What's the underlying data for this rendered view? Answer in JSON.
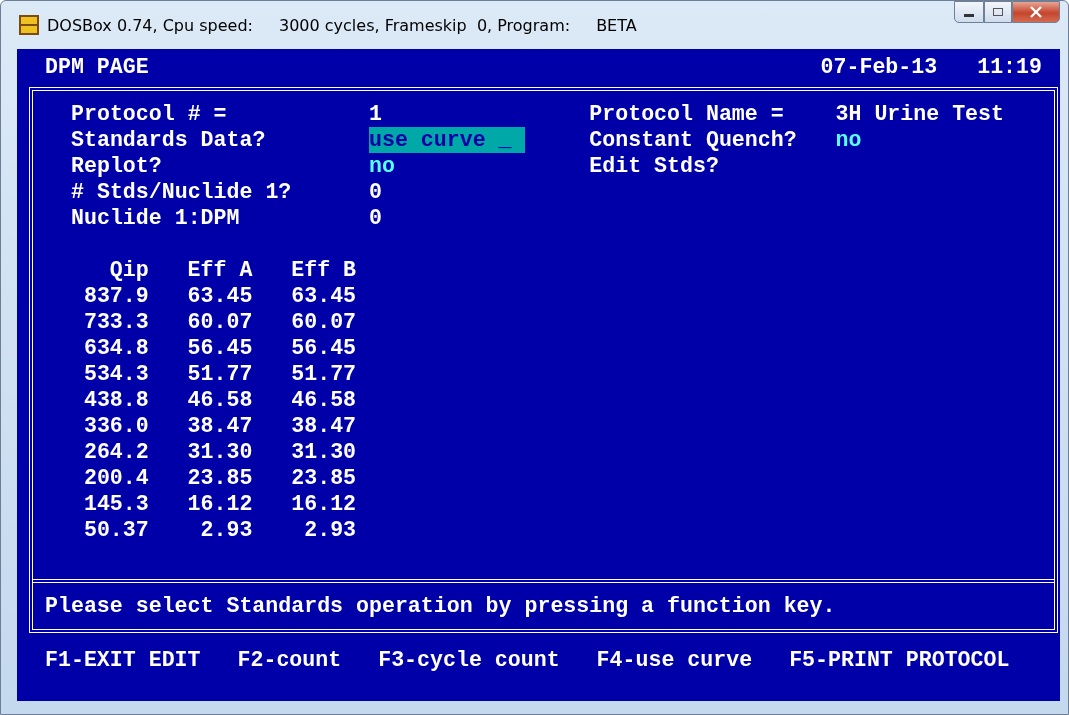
{
  "window": {
    "title_parts": [
      "DOSBox 0.74, Cpu speed:",
      "3000 cycles, Frameskip  0, Program:",
      "BETA"
    ]
  },
  "header": {
    "page": "DPM PAGE",
    "date": "07-Feb-13",
    "time": "11:19"
  },
  "left_fields": [
    {
      "label": "Protocol # =",
      "value": "1",
      "kind": "plain"
    },
    {
      "label": "Standards Data?",
      "value": "use curve _",
      "kind": "input"
    },
    {
      "label": "Replot?",
      "value": "no",
      "kind": "option"
    },
    {
      "label": "# Stds/Nuclide 1?",
      "value": "0",
      "kind": "plain"
    },
    {
      "label": "Nuclide 1:DPM",
      "value": "0",
      "kind": "plain"
    }
  ],
  "right_fields": [
    {
      "label": "Protocol Name =",
      "value": "3H Urine Test",
      "kind": "plain"
    },
    {
      "label": "Constant Quench?",
      "value": "no",
      "kind": "option"
    },
    {
      "label": "Edit Stds?",
      "kind": "none"
    }
  ],
  "table": {
    "columns": [
      "Qip",
      "Eff A",
      "Eff B"
    ],
    "rows": [
      [
        "837.9",
        "63.45",
        "63.45"
      ],
      [
        "733.3",
        "60.07",
        "60.07"
      ],
      [
        "634.8",
        "56.45",
        "56.45"
      ],
      [
        "534.3",
        "51.77",
        "51.77"
      ],
      [
        "438.8",
        "46.58",
        "46.58"
      ],
      [
        "336.0",
        "38.47",
        "38.47"
      ],
      [
        "264.2",
        "31.30",
        "31.30"
      ],
      [
        "200.4",
        "23.85",
        "23.85"
      ],
      [
        "145.3",
        "16.12",
        "16.12"
      ],
      [
        "50.37",
        "2.93",
        "2.93"
      ]
    ]
  },
  "message": "Please select Standards operation by pressing a function key.",
  "function_keys": [
    "F1-EXIT EDIT",
    "F2-count",
    "F3-cycle count",
    "F4-use curve",
    "F5-PRINT PROTOCOL"
  ]
}
